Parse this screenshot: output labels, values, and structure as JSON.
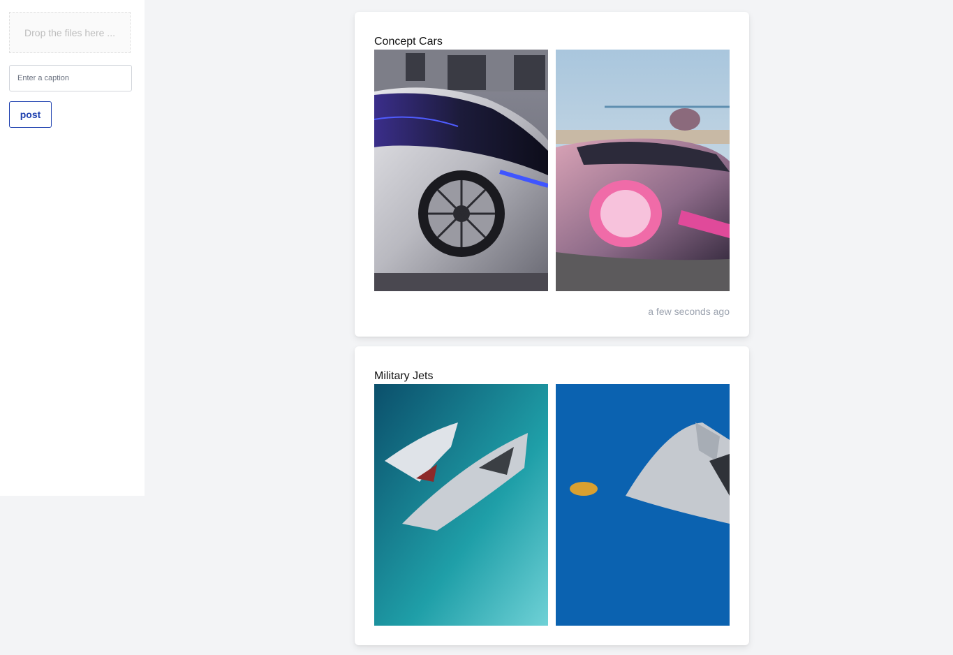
{
  "upload": {
    "dropzone_text": "Drop the files here ...",
    "caption_placeholder": "Enter a caption",
    "post_label": "post"
  },
  "posts": [
    {
      "title": "Concept Cars",
      "timestamp": "a few seconds ago",
      "images": [
        "concept-car-silver-image",
        "concept-car-pink-image"
      ]
    },
    {
      "title": "Military Jets",
      "timestamp": "",
      "images": [
        "stealth-jet-image",
        "fighter-jet-image"
      ]
    }
  ],
  "colors": {
    "accent": "#1e40af",
    "background": "#f3f4f6",
    "muted_text": "#9ca3af"
  }
}
